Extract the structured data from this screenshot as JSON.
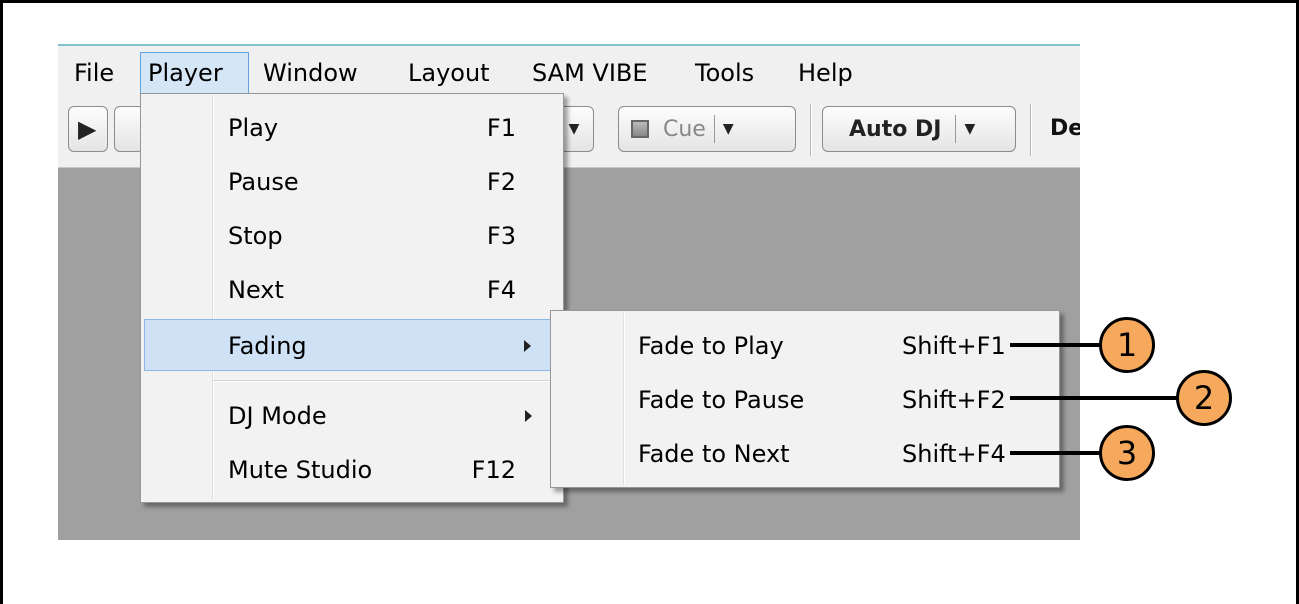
{
  "menubar": [
    "File",
    "Player",
    "Window",
    "Layout",
    "SAM VIBE",
    "Tools",
    "Help"
  ],
  "toolbar": {
    "play_icon": "play-icon",
    "cue_label": "Cue",
    "autodj_label": "Auto DJ",
    "truncated_label": "De"
  },
  "player_menu": {
    "items": [
      {
        "label": "Play",
        "shortcut": "F1"
      },
      {
        "label": "Pause",
        "shortcut": "F2"
      },
      {
        "label": "Stop",
        "shortcut": "F3"
      },
      {
        "label": "Next",
        "shortcut": "F4"
      },
      {
        "label": "Fading",
        "shortcut": "",
        "submenu": true
      },
      {
        "label": "DJ Mode",
        "shortcut": "",
        "submenu": true
      },
      {
        "label": "Mute Studio",
        "shortcut": "F12"
      }
    ]
  },
  "fading_menu": {
    "items": [
      {
        "label": "Fade to Play",
        "shortcut": "Shift+F1"
      },
      {
        "label": "Fade to Pause",
        "shortcut": "Shift+F2"
      },
      {
        "label": "Fade to Next",
        "shortcut": "Shift+F4"
      }
    ]
  },
  "callouts": [
    "1",
    "2",
    "3"
  ],
  "colors": {
    "callout_fill": "#f6a95c",
    "highlight": "#cfe2f5",
    "workspace": "#a0a0a0"
  }
}
